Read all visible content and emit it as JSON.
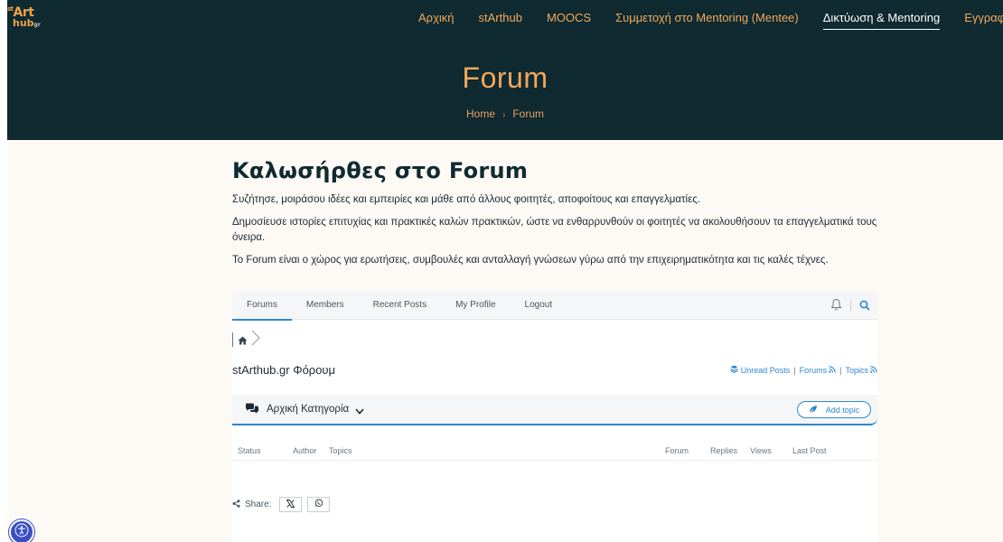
{
  "brand": {
    "logo_line1": "st",
    "logo_line1b": "Art",
    "logo_line2": "hub",
    "logo_sup": "gr"
  },
  "topnav": [
    "Αρχική",
    "stArthub",
    "MOOCS",
    "Συμμετοχή στο Mentoring (Mentee)",
    "Δικτύωση & Mentoring",
    "Εγγραφή"
  ],
  "hero": {
    "title": "Forum",
    "breadcrumb_home": "Home",
    "breadcrumb_current": "Forum"
  },
  "intro": {
    "heading": "Καλωσήρθες στο Forum",
    "p1": "Συζήτησε, μοιράσου ιδέες και εμπειρίες και μάθε από άλλους φοιτητές, αποφοίτους και επαγγελματίες.",
    "p2": "Δημοσίευσε ιστορίες επιτυχίας και πρακτικές καλών πρακτικών, ώστε να ενθαρρυνθούν οι φοιτητές να ακολουθήσουν τα επαγγελματικά τους όνειρα.",
    "p3": "Το Forum είναι ο χώρος για ερωτήσεις, συμβουλές και ανταλλαγή γνώσεων γύρω από την επιχειρηματικότητα και τις καλές τέχνες."
  },
  "forum": {
    "tabs": [
      "Forums",
      "Members",
      "Recent Posts",
      "My Profile",
      "Logout"
    ],
    "title": "stArthub.gr Φόρουμ",
    "links": {
      "unread": "Unread Posts",
      "forums": "Forums",
      "topics": "Topics"
    },
    "category": "Αρχική Κατηγορία",
    "add_topic": "Add topic",
    "columns": {
      "status": "Status",
      "author": "Author",
      "topics": "Topics",
      "forum": "Forum",
      "replies": "Replies",
      "views": "Views",
      "last_post": "Last Post"
    },
    "share_label": "Share:"
  },
  "colors": {
    "hero_bg": "#0f2a30",
    "accent_orange": "#f2a85c",
    "forum_blue": "#2e87d1",
    "a11y_blue": "#3a4fc4"
  },
  "icons": [
    "home-icon",
    "chevron-right-icon",
    "bell-icon",
    "search-icon",
    "stack-icon",
    "rss-icon",
    "comments-icon",
    "chevron-down-icon",
    "leaf-icon",
    "share-icon",
    "x-logo-icon",
    "whatsapp-icon",
    "accessibility-icon"
  ]
}
